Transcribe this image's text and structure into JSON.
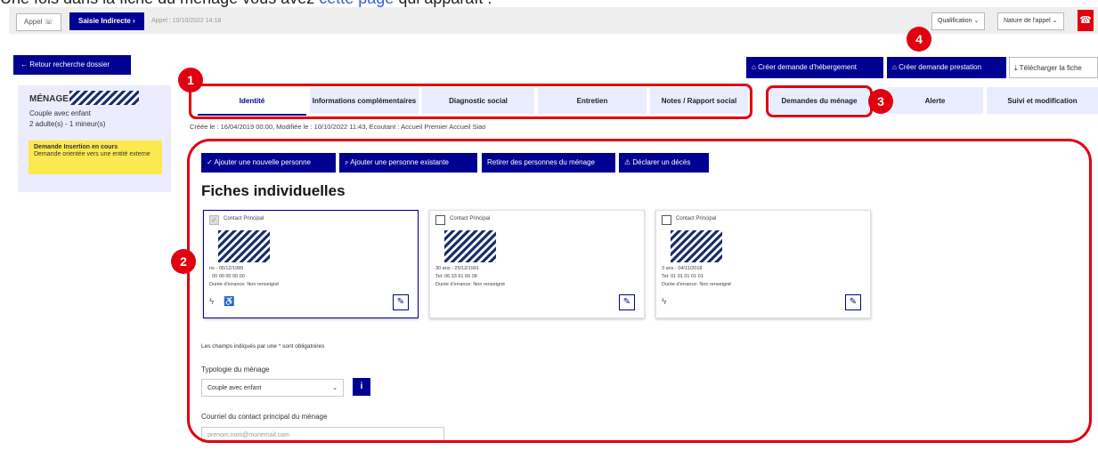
{
  "caption": {
    "text_before": "Une fois dans la fiche du ménage vous avez",
    "link": "cette page",
    "text_after": "qui apparaît :"
  },
  "appbar": {
    "appel_label": "Appel",
    "phone_icon": "phone-icon",
    "saisie_label": "Saisie Indirecte",
    "appel_date": "Appel : 10/10/2022 14:18",
    "qualification": "Qualification",
    "nature": "Nature de l'appel"
  },
  "retour_label": "Retour recherche dossier",
  "sidebar": {
    "title": "MÉNAGE",
    "type": "Couple avec enfant",
    "composition": "2 adulte(s) - 1 mineur(s)",
    "status_title": "Demande Insertion en cours",
    "status_desc": "Demande orientée vers une entité externe"
  },
  "top_actions": {
    "hebergement": "Créer demande d'hébergement",
    "prestation": "Créer demande prestation",
    "telecharger": "Télécharger la fiche"
  },
  "tabs": [
    {
      "label": "Identité",
      "active": true
    },
    {
      "label": "Informations complémentaires",
      "active": false
    },
    {
      "label": "Diagnostic social",
      "active": false
    },
    {
      "label": "Entretien",
      "active": false
    },
    {
      "label": "Notes / Rapport social",
      "active": false
    },
    {
      "label": "Demandes du ménage",
      "active": false
    },
    {
      "label": "Alerte",
      "active": false
    },
    {
      "label": "Suivi et modification",
      "active": false
    }
  ],
  "created_line": "Créée le : 16/04/2019 00:00, Modifiée le : 10/10/2022 11:43, Ecoutant : Accueil Premier Accueil Siao",
  "actions": {
    "add_new": "Ajouter une nouvelle personne",
    "add_existing": "Ajouter une personne existante",
    "remove": "Retirer des personnes du ménage",
    "deces": "Déclarer un décès"
  },
  "section_title": "Fiches individuelles",
  "cards": [
    {
      "checkbox_label": "Contact Principal",
      "age": "ns - 05/12/1989",
      "tel": ": 00 00 00 00 00",
      "errance": "Durée d'errance: Non renseigné",
      "checked": true
    },
    {
      "checkbox_label": "Contact Principal",
      "age": "30 ans - 25/12/1991",
      "tel": "Tel: 06 33 61 66 08",
      "errance": "Durée d'errance: Non renseigné",
      "checked": false
    },
    {
      "checkbox_label": "Contact Principal",
      "age": "3 ans - 04/11/2018",
      "tel": "Tel: 01 01 01 01 01",
      "errance": "Durée d'errance: Non renseigné",
      "checked": false
    }
  ],
  "form": {
    "required_note_before": "Les champs indiqués par une",
    "required_star": "*",
    "required_note_after": "sont obligatoires",
    "typologie_label": "Typologie du ménage",
    "typologie_value": "Couple avec enfant",
    "courriel_label": "Courriel du contact principal du ménage",
    "courriel_value": "prenom.nom@monemail.com"
  },
  "callouts": [
    "1",
    "2",
    "3",
    "4"
  ],
  "colors": {
    "primary": "#000091",
    "annotation": "#e1000f",
    "status": "#fce94f"
  }
}
